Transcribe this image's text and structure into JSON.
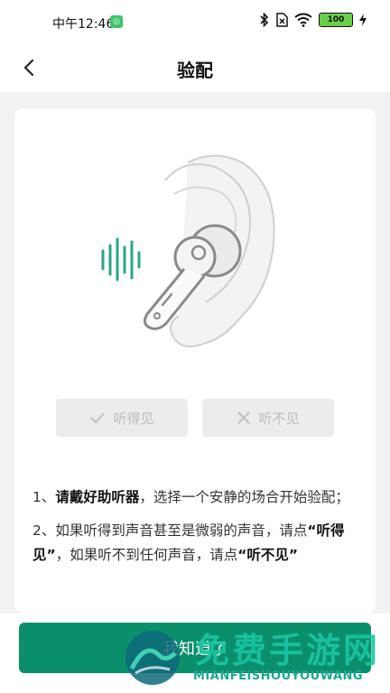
{
  "status": {
    "time": "中午12:46",
    "battery": "100"
  },
  "nav": {
    "title": "验配"
  },
  "buttons": {
    "hear": "听得见",
    "not_hear": "听不见"
  },
  "instructions": {
    "step1_prefix": "1、",
    "step1_bold": "请戴好助听器",
    "step1_rest": "，选择一个安静的场合开始验配；",
    "step2_prefix": "2、如果听得到声音甚至是微弱的声音，请点",
    "step2_bold1": "“听得见”",
    "step2_middle": "，如果听不到任何声音，请点",
    "step2_bold2": "“听不见”"
  },
  "primary": {
    "label": "我知道了"
  },
  "watermark": {
    "title": "免费手游网",
    "subtitle": "MIANFEISHOUYOUWANG"
  },
  "colors": {
    "accent": "#0b8f6a",
    "sound_wave": "#2aa58a"
  }
}
